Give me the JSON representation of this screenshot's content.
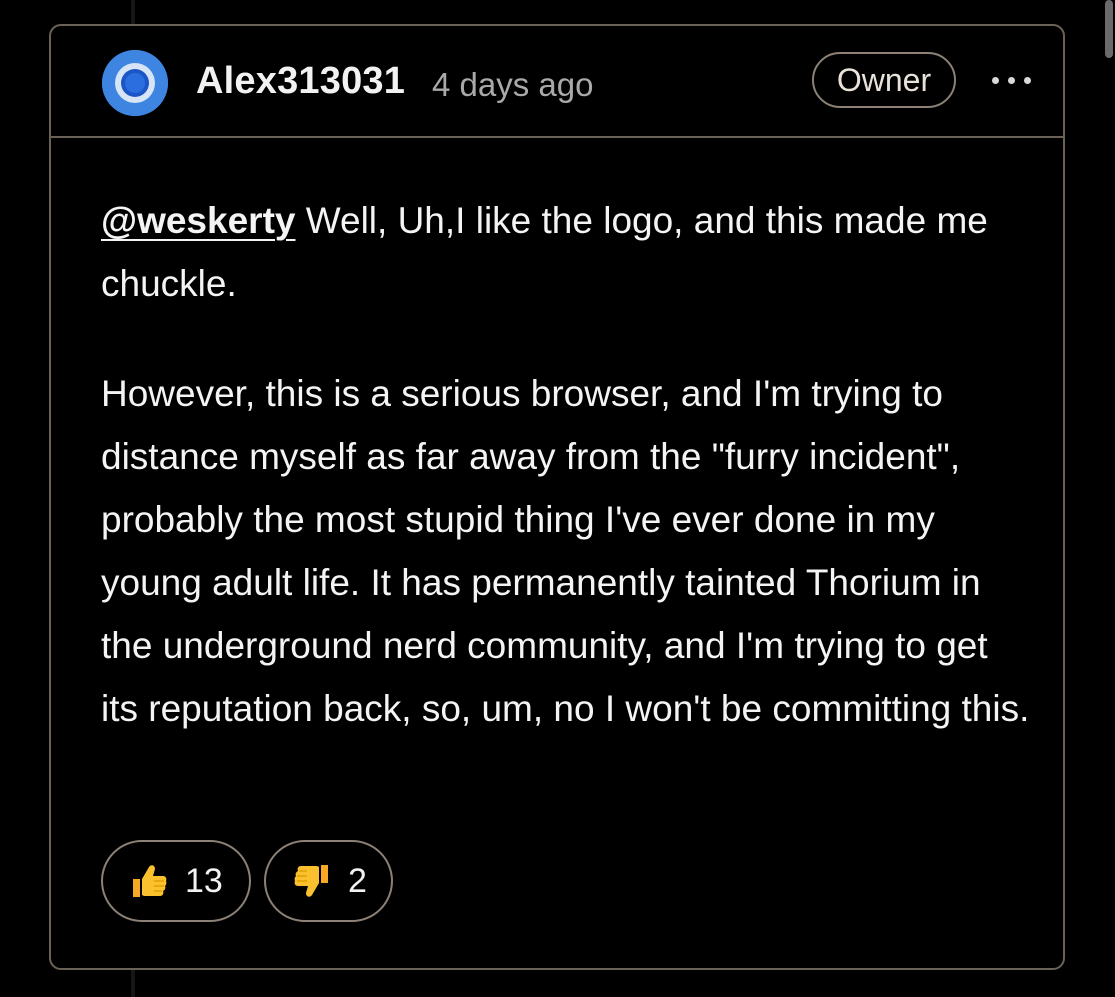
{
  "comment": {
    "author": "Alex313031",
    "timestamp": "4 days ago",
    "badge": "Owner",
    "menu_icon": "kebab-menu-icon",
    "mention": "@weskerty",
    "paragraph1_rest": " Well, Uh,I like the logo, and this made me chuckle.",
    "paragraph2": "However, this is a serious browser, and I'm trying to distance myself as far away from the \"furry incident\", probably the most stupid thing I've ever done in my young adult life. It has permanently tainted Thorium in the underground nerd community, and I'm trying to get its reputation back, so, um, no I won't be committing this.",
    "reactions": [
      {
        "icon": "thumbs-up-icon",
        "count": "13"
      },
      {
        "icon": "thumbs-down-icon",
        "count": "2"
      }
    ]
  },
  "colors": {
    "background": "#000000",
    "card_border": "#6b6257",
    "avatar_blue": "#3d85e0",
    "text": "#f4f4f4",
    "muted_text": "#a9a9a9",
    "emoji_yellow": "#fbc02d"
  }
}
